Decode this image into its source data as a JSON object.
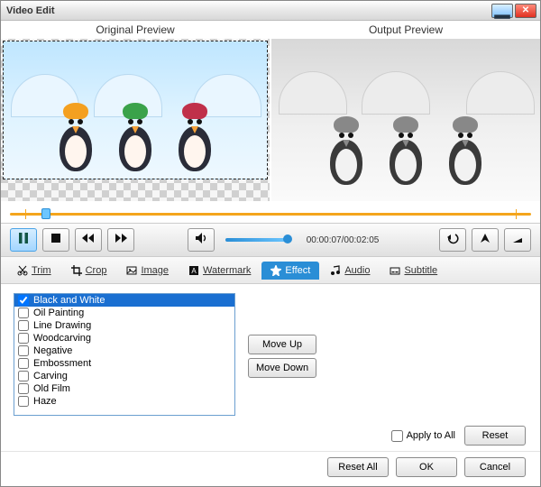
{
  "window": {
    "title": "Video Edit"
  },
  "previews": {
    "original_label": "Original Preview",
    "output_label": "Output Preview"
  },
  "playback": {
    "timecode": "00:00:07/00:02:05"
  },
  "tabs": {
    "items": [
      {
        "label": "Trim",
        "icon": "scissors-icon"
      },
      {
        "label": "Crop",
        "icon": "crop-icon"
      },
      {
        "label": "Image",
        "icon": "image-icon"
      },
      {
        "label": "Watermark",
        "icon": "text-icon"
      },
      {
        "label": "Effect",
        "icon": "star-icon"
      },
      {
        "label": "Audio",
        "icon": "music-note-icon"
      },
      {
        "label": "Subtitle",
        "icon": "subtitle-icon"
      }
    ],
    "active_index": 4
  },
  "effects": {
    "items": [
      "Black and White",
      "Oil Painting",
      "Line Drawing",
      "Woodcarving",
      "Negative",
      "Embossment",
      "Carving",
      "Old Film",
      "Haze"
    ],
    "selected_index": 0,
    "checked": [
      true,
      false,
      false,
      false,
      false,
      false,
      false,
      false,
      false
    ],
    "move_up_label": "Move Up",
    "move_down_label": "Move Down"
  },
  "footer": {
    "apply_to_all_label": "Apply to All",
    "reset_label": "Reset",
    "reset_all_label": "Reset All",
    "ok_label": "OK",
    "cancel_label": "Cancel"
  }
}
